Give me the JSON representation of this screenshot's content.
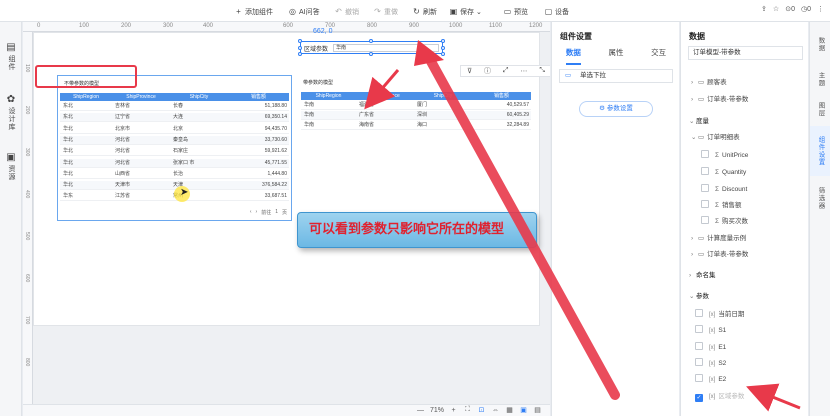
{
  "toolbar": {
    "add_component": "添加组件",
    "ai_qa": "AI问答",
    "undo": "撤销",
    "redo": "重做",
    "refresh": "刷新",
    "save": "保存",
    "preview": "预览",
    "settings": "设备",
    "notif_count": "0",
    "user_count": "0"
  },
  "left_rail": [
    "组件",
    "设计库",
    "资源"
  ],
  "ruler": {
    "top_ticks": [
      "0",
      "100",
      "200",
      "300",
      "400",
      "600",
      "700",
      "800",
      "900",
      "1000",
      "1100",
      "1200"
    ],
    "left_ticks": [
      "100",
      "200",
      "300",
      "400",
      "500",
      "600",
      "700",
      "800"
    ]
  },
  "canvas": {
    "coord_readout": "662, 0",
    "dropdown_label": "区域参数",
    "dropdown_value": "华南",
    "annotation": "可以看到参数只影响它所在的模型"
  },
  "table_left": {
    "title": "不带参数的模型",
    "columns": [
      "ShipRegion",
      "ShipProvince",
      "ShipCity",
      "销售额"
    ],
    "rows": [
      [
        "东北",
        "吉林省",
        "长春",
        "51,188.80"
      ],
      [
        "东北",
        "辽宁省",
        "大连",
        "69,350.14"
      ],
      [
        "华北",
        "北京市",
        "北京",
        "94,435.70"
      ],
      [
        "华北",
        "河北省",
        "秦皇岛",
        "33,730.60"
      ],
      [
        "华北",
        "河北省",
        "石家庄",
        "59,921.62"
      ],
      [
        "华北",
        "河北省",
        "张家口 市",
        "45,771.55"
      ],
      [
        "华北",
        "山西省",
        "长治",
        "1,444.80"
      ],
      [
        "华北",
        "天津市",
        "天津",
        "376,584.22"
      ],
      [
        "华东",
        "江苏省",
        "常州",
        "33,687.51"
      ]
    ],
    "pager": [
      "前往",
      "1",
      "页"
    ]
  },
  "table_right": {
    "title": "带参数的模型",
    "columns": [
      "ShipRegion",
      "ShipProvince",
      "ShipCity",
      "销售额"
    ],
    "rows": [
      [
        "华南",
        "福建省",
        "厦门",
        "40,529.57"
      ],
      [
        "华南",
        "广东省",
        "深圳",
        "60,405.29"
      ],
      [
        "华南",
        "海南省",
        "海口",
        "32,284.89"
      ]
    ]
  },
  "zoom": "71%",
  "settings_panel": {
    "title": "组件设置",
    "tabs": [
      "数据",
      "属性",
      "交互"
    ],
    "field": "单选下拉",
    "button": "参数设置"
  },
  "data_panel": {
    "title": "数据",
    "model": "订单模型-带参数",
    "items": [
      {
        "kind": "folder",
        "label": "顾客表"
      },
      {
        "kind": "folder",
        "label": "订单表-带参数"
      },
      {
        "kind": "group",
        "label": "度量"
      },
      {
        "kind": "folder-open",
        "label": "订单明细表"
      },
      {
        "kind": "measure",
        "label": "UnitPrice"
      },
      {
        "kind": "measure",
        "label": "Quantity"
      },
      {
        "kind": "measure",
        "label": "Discount"
      },
      {
        "kind": "measure",
        "label": "销售额"
      },
      {
        "kind": "measure",
        "label": "购买次数"
      },
      {
        "kind": "folder",
        "label": "计算度量示例"
      },
      {
        "kind": "folder",
        "label": "订单表-带参数"
      },
      {
        "kind": "group",
        "label": "命名集"
      },
      {
        "kind": "group",
        "label": "参数"
      },
      {
        "kind": "param",
        "label": "当前日期"
      },
      {
        "kind": "param",
        "label": "S1"
      },
      {
        "kind": "param",
        "label": "E1"
      },
      {
        "kind": "param",
        "label": "S2"
      },
      {
        "kind": "param",
        "label": "E2"
      },
      {
        "kind": "param-checked",
        "label": "区域参数"
      }
    ]
  },
  "right_rail": [
    "数据",
    "主题",
    "图层",
    "组件设置",
    "筛选器"
  ]
}
